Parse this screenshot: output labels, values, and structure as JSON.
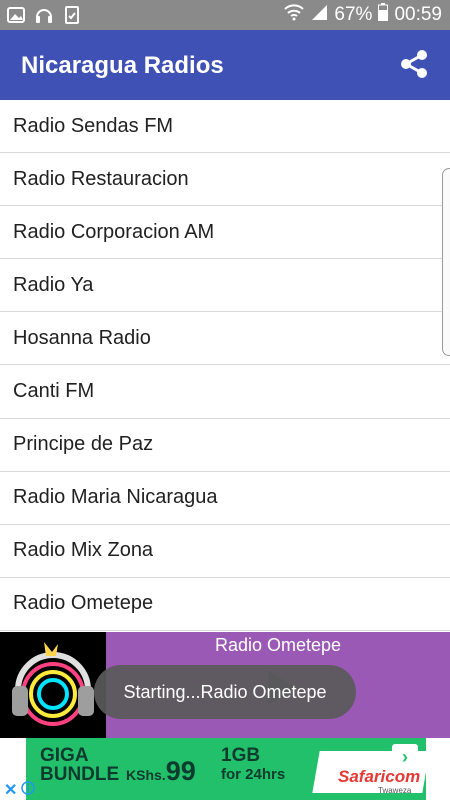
{
  "status_bar": {
    "battery": "67%",
    "time": "00:59",
    "icons": [
      "photo-icon",
      "headphones-icon",
      "saved-icon",
      "wifi-icon",
      "signal-icon",
      "battery-icon"
    ]
  },
  "app_bar": {
    "title": "Nicaragua Radios",
    "share_icon": "share-icon",
    "color": "#3f51b5"
  },
  "stations": [
    {
      "label": "Radio Sendas FM"
    },
    {
      "label": "Radio Restauracion"
    },
    {
      "label": "Radio Corporacion AM"
    },
    {
      "label": "Radio Ya"
    },
    {
      "label": "Hosanna Radio"
    },
    {
      "label": "Canti FM"
    },
    {
      "label": "Principe de Paz"
    },
    {
      "label": "Radio Maria Nicaragua"
    },
    {
      "label": "Radio Mix Zona"
    },
    {
      "label": "Radio Ometepe"
    }
  ],
  "player": {
    "now_playing": "Radio Ometepe",
    "color": "#9b59b6"
  },
  "toast": {
    "message": "Starting...Radio Ometepe"
  },
  "ad": {
    "line1": "GIGA",
    "line2": "BUNDLE",
    "currency": "KShs.",
    "price": "99",
    "data": "1GB",
    "duration": "for 24hrs",
    "brand": "Safaricom",
    "tagline": "Twaweza"
  }
}
